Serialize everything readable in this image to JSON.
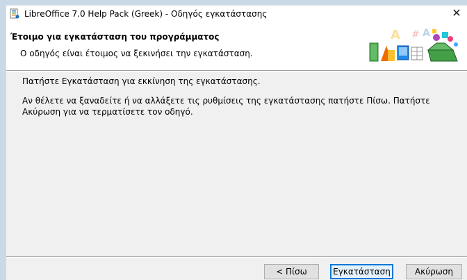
{
  "window": {
    "title": "LibreOffice 7.0 Help Pack (Greek) - Οδηγός εγκατάστασης",
    "close_glyph": "✕"
  },
  "banner": {
    "title": "Έτοιμο για εγκατάσταση του προγράμματος",
    "subtitle": "Ο οδηγός είναι έτοιμος να ξεκινήσει την εγκατάσταση."
  },
  "body": {
    "line1": "Πατήστε Εγκατάσταση για εκκίνηση της εγκατάστασης.",
    "line2": "Αν θέλετε να ξαναδείτε ή να αλλάξετε τις ρυθμίσεις της εγκατάστασης πατήστε Πίσω. Πατήστε Ακύρωση για να τερματίσετε τον οδηγό."
  },
  "buttons": {
    "back": "< Πίσω",
    "install": "Εγκατάσταση",
    "cancel": "Ακύρωση"
  },
  "colors": {
    "accent": "#0078d7",
    "background": "#f0f0f0"
  }
}
